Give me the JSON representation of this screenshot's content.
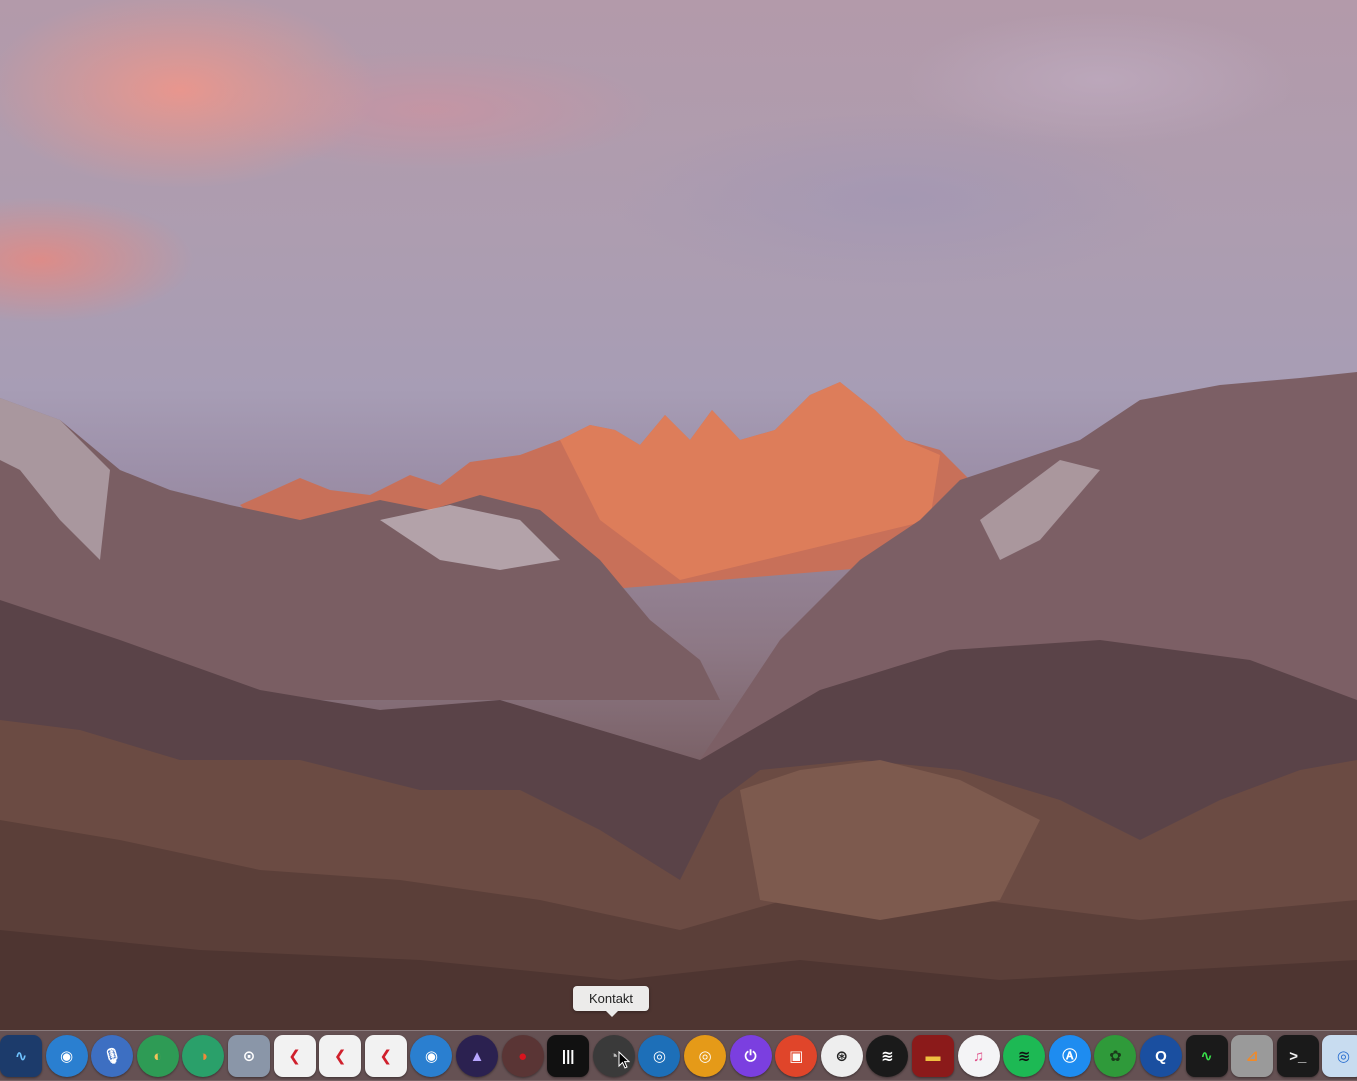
{
  "tooltip": {
    "text": "Kontakt"
  },
  "dock": {
    "items": [
      {
        "id": "audio-monitor",
        "icon": "waveform-icon",
        "color": "#1c3b6b",
        "glyph": "∿",
        "fg": "#6fc3ff"
      },
      {
        "id": "eye-app-1",
        "icon": "eye-icon",
        "color": "#2a7fd0",
        "glyph": "◉",
        "fg": "#ffffff",
        "round": true
      },
      {
        "id": "podcast",
        "icon": "microphone-icon",
        "color": "#3d6fc2",
        "glyph": "🎙",
        "fg": "#ffffff",
        "round": true
      },
      {
        "id": "app-green-1",
        "icon": "leaf-icon",
        "color": "#2e9b55",
        "glyph": "◐",
        "fg": "#f3c35a",
        "round": true
      },
      {
        "id": "app-green-2",
        "icon": "leaf-icon",
        "color": "#2aa06a",
        "glyph": "◑",
        "fg": "#f08a3a",
        "round": true
      },
      {
        "id": "disk-utility",
        "icon": "disk-icon",
        "color": "#8a96a8",
        "glyph": "⊙",
        "fg": "#ffffff"
      },
      {
        "id": "cubase-1",
        "icon": "cubase-icon",
        "color": "#f2f2f2",
        "glyph": "❮",
        "fg": "#d0202c"
      },
      {
        "id": "cubase-2",
        "icon": "cubase-icon",
        "color": "#f2f2f2",
        "glyph": "❮",
        "fg": "#d0202c"
      },
      {
        "id": "cubase-3",
        "icon": "cubase-icon",
        "color": "#f2f2f2",
        "glyph": "❮",
        "fg": "#d0202c"
      },
      {
        "id": "eye-app-2",
        "icon": "eye-icon",
        "color": "#2a7fd0",
        "glyph": "◉",
        "fg": "#ffffff",
        "round": true
      },
      {
        "id": "pro-tools",
        "icon": "pro-tools-icon",
        "color": "#2b2150",
        "glyph": "▲",
        "fg": "#b8a6ff",
        "round": true
      },
      {
        "id": "cherry",
        "icon": "cherry-icon",
        "color": "#5a3535",
        "glyph": "●",
        "fg": "#d8141e",
        "round": true
      },
      {
        "id": "instrument",
        "icon": "bars-icon",
        "color": "#111111",
        "glyph": "|||",
        "fg": "#ffffff"
      },
      {
        "id": "kontakt",
        "icon": "kontakt-icon",
        "color": "#3a3a3a",
        "glyph": "◔",
        "fg": "#bdbdbd",
        "round": true
      },
      {
        "id": "app-blue-swirl",
        "icon": "swirl-icon",
        "color": "#1d6fb8",
        "glyph": "◎",
        "fg": "#ffffff",
        "round": true
      },
      {
        "id": "app-orange-swirl",
        "icon": "swirl-icon",
        "color": "#e59a18",
        "glyph": "◎",
        "fg": "#ffffff",
        "round": true
      },
      {
        "id": "power-app",
        "icon": "power-icon",
        "color": "#7b3fe0",
        "glyph": "⏻",
        "fg": "#ffffff",
        "round": true
      },
      {
        "id": "stop-app",
        "icon": "stop-icon",
        "color": "#e0452a",
        "glyph": "▣",
        "fg": "#ffffff",
        "round": true
      },
      {
        "id": "cue-app",
        "icon": "cue-icon",
        "color": "#eeeeee",
        "glyph": "⊛",
        "fg": "#222222",
        "round": true
      },
      {
        "id": "stripes-app",
        "icon": "stripes-icon",
        "color": "#1a1a1a",
        "glyph": "≋",
        "fg": "#ffffff",
        "round": true
      },
      {
        "id": "amplitube",
        "icon": "amp-icon",
        "color": "#8b1a1a",
        "glyph": "▬",
        "fg": "#f0c040"
      },
      {
        "id": "itunes",
        "icon": "music-note-icon",
        "color": "#f4f4f6",
        "glyph": "♫",
        "fg": "#e0508a",
        "round": true
      },
      {
        "id": "spotify",
        "icon": "spotify-icon",
        "color": "#1db954",
        "glyph": "≋",
        "fg": "#111111",
        "round": true
      },
      {
        "id": "app-store",
        "icon": "app-store-icon",
        "color": "#1e8cf0",
        "glyph": "Ⓐ",
        "fg": "#ffffff",
        "round": true
      },
      {
        "id": "gear-app",
        "icon": "gear-icon",
        "color": "#2f9a3a",
        "glyph": "✿",
        "fg": "#1b3a1b",
        "round": true
      },
      {
        "id": "quicktime",
        "icon": "quicktime-icon",
        "color": "#1a4fa0",
        "glyph": "Q",
        "fg": "#ffffff",
        "round": true
      },
      {
        "id": "activity-monitor",
        "icon": "activity-monitor-icon",
        "color": "#1a1a1a",
        "glyph": "∿",
        "fg": "#38e04a"
      },
      {
        "id": "instruments",
        "icon": "instruments-icon",
        "color": "#9a9a9a",
        "glyph": "⊿",
        "fg": "#f08a2a"
      },
      {
        "id": "terminal",
        "icon": "terminal-icon",
        "color": "#1a1a1a",
        "glyph": ">_",
        "fg": "#f2f2f2"
      },
      {
        "id": "preview",
        "icon": "preview-icon",
        "color": "#c8dcf0",
        "glyph": "◎",
        "fg": "#2a6fd0"
      }
    ]
  }
}
